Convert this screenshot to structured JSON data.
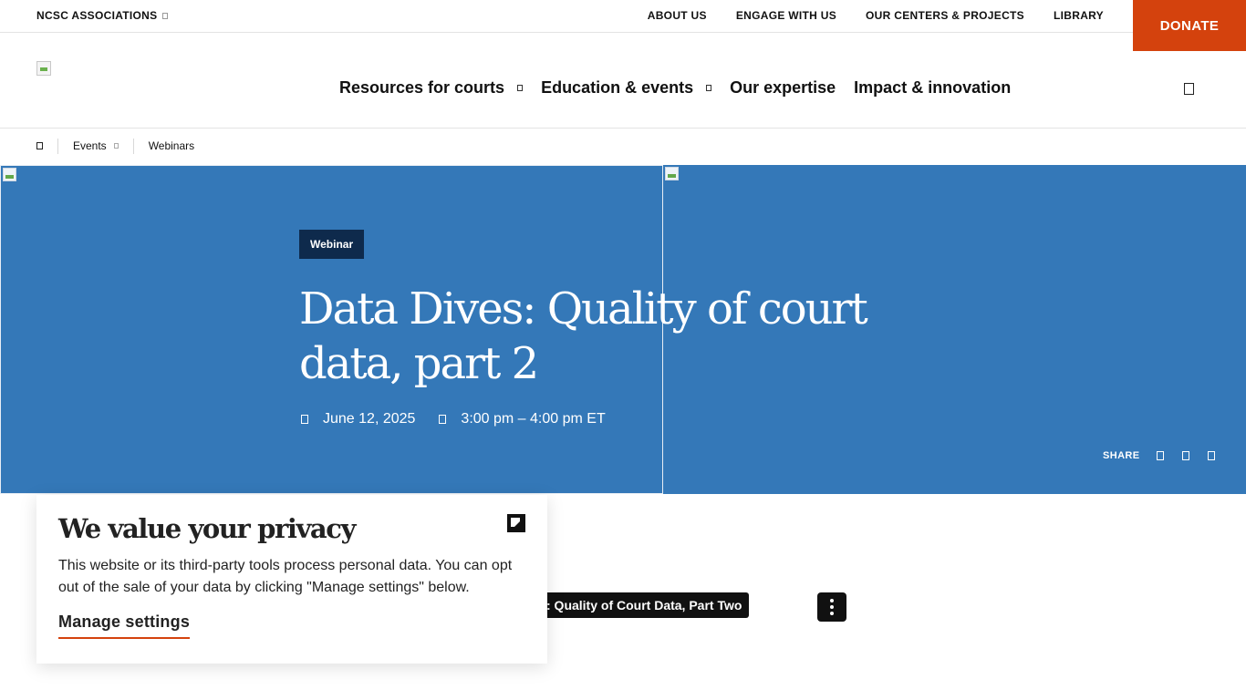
{
  "utility_bar": {
    "associations_label": "NCSC ASSOCIATIONS",
    "links": [
      "ABOUT US",
      "ENGAGE WITH US",
      "OUR CENTERS & PROJECTS",
      "LIBRARY"
    ],
    "donate_label": "DONATE"
  },
  "main_nav": {
    "items": [
      {
        "label": "Resources for courts",
        "has_dropdown": true
      },
      {
        "label": "Education & events",
        "has_dropdown": true
      },
      {
        "label": "Our expertise",
        "has_dropdown": false
      },
      {
        "label": "Impact & innovation",
        "has_dropdown": false
      }
    ],
    "search_icon": "search-icon"
  },
  "breadcrumb": {
    "home_icon": "home-icon",
    "items": [
      "Events",
      "Webinars"
    ]
  },
  "hero": {
    "badge": "Webinar",
    "title": "Data Dives: Quality of court data, part 2",
    "date": "June 12, 2025",
    "time": "3:00 pm – 4:00 pm ET",
    "share_label": "SHARE",
    "background_color": "#3478b8"
  },
  "video": {
    "title": ": Quality of Court Data, Part Two"
  },
  "privacy": {
    "title": "We value your privacy",
    "text": "This website or its third-party tools process personal data. You can opt out of the sale of your data by clicking \"Manage settings\" below.",
    "link_label": "Manage settings"
  },
  "colors": {
    "accent": "#d4420d",
    "badge": "#0e2a4c"
  }
}
